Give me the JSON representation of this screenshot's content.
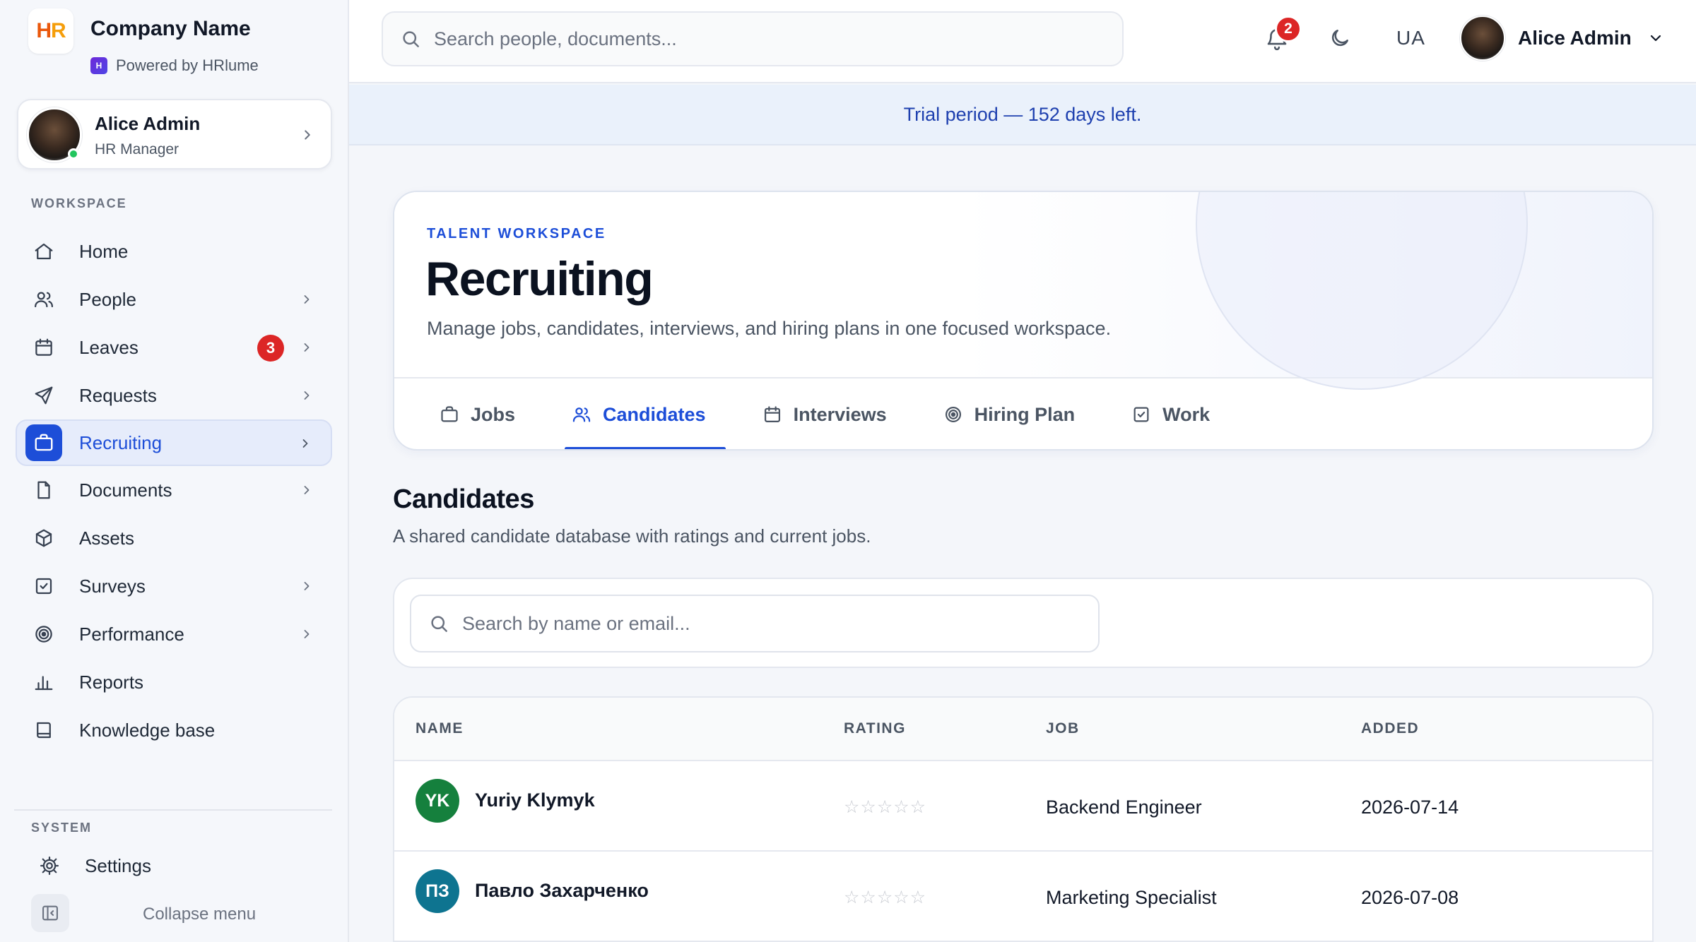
{
  "brand": {
    "logo_text_h": "H",
    "logo_text_r": "R",
    "company_name": "Company Name",
    "powered_by": "Powered by HRlume",
    "accent_color": "#1d4ed8"
  },
  "user_card": {
    "name": "Alice Admin",
    "role": "HR Manager",
    "status": "online"
  },
  "sidebar": {
    "workspace_label": "WORKSPACE",
    "items": [
      {
        "label": "Home",
        "icon": "home-icon",
        "has_chevron": false
      },
      {
        "label": "People",
        "icon": "people-icon",
        "has_chevron": true
      },
      {
        "label": "Leaves",
        "icon": "calendar-icon",
        "has_chevron": true,
        "badge": "3"
      },
      {
        "label": "Requests",
        "icon": "send-icon",
        "has_chevron": true
      },
      {
        "label": "Recruiting",
        "icon": "briefcase-icon",
        "has_chevron": true,
        "active": true
      },
      {
        "label": "Documents",
        "icon": "document-icon",
        "has_chevron": true
      },
      {
        "label": "Assets",
        "icon": "box-icon",
        "has_chevron": false
      },
      {
        "label": "Surveys",
        "icon": "checkbox-icon",
        "has_chevron": true
      },
      {
        "label": "Performance",
        "icon": "target-icon",
        "has_chevron": true
      },
      {
        "label": "Reports",
        "icon": "bar-chart-icon",
        "has_chevron": false
      },
      {
        "label": "Knowledge base",
        "icon": "book-icon",
        "has_chevron": false
      }
    ],
    "system_label": "SYSTEM",
    "settings_label": "Settings",
    "collapse_label": "Collapse menu"
  },
  "topbar": {
    "search_placeholder": "Search people, documents...",
    "notifications_count": "2",
    "language": "UA",
    "user_name": "Alice Admin"
  },
  "trial_banner": "Trial period — 152 days left.",
  "hero": {
    "eyebrow": "TALENT WORKSPACE",
    "title": "Recruiting",
    "subtitle": "Manage jobs, candidates, interviews, and hiring plans in one focused workspace.",
    "tabs": [
      {
        "label": "Jobs",
        "icon": "briefcase-icon"
      },
      {
        "label": "Candidates",
        "icon": "people-icon",
        "active": true
      },
      {
        "label": "Interviews",
        "icon": "calendar-icon"
      },
      {
        "label": "Hiring Plan",
        "icon": "target-icon"
      },
      {
        "label": "Work",
        "icon": "checkbox-icon"
      }
    ]
  },
  "candidates": {
    "title": "Candidates",
    "subtitle": "A shared candidate database with ratings and current jobs.",
    "search_placeholder": "Search by name or email...",
    "columns": [
      "NAME",
      "RATING",
      "JOB",
      "ADDED"
    ],
    "rows": [
      {
        "initials": "YK",
        "name": "Yuriy Klymyk",
        "rating": 0,
        "rating_max": 5,
        "job": "Backend Engineer",
        "added": "2026-07-14",
        "avatar_color": "#15803d"
      },
      {
        "initials": "ПЗ",
        "name": "Павло Захарченко",
        "rating": 0,
        "rating_max": 5,
        "job": "Marketing Specialist",
        "added": "2026-07-08",
        "avatar_color": "#0e7490"
      }
    ]
  }
}
